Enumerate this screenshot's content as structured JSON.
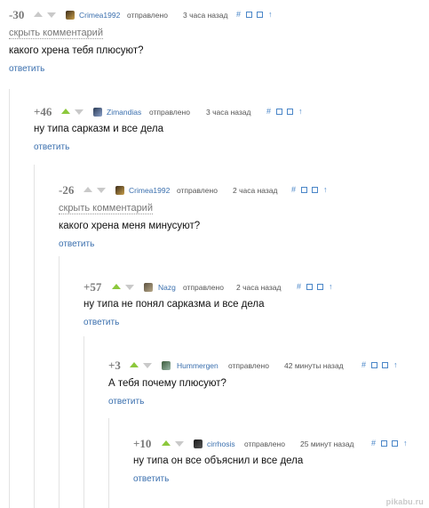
{
  "common": {
    "posted_label": "отправлено",
    "reply_label": "ответить",
    "hide_label": "скрыть комментарий",
    "tools": [
      "#",
      "⊟",
      "⊡",
      "↑"
    ],
    "colors": {
      "up_active": "#8cc83c",
      "arrow_inactive": "#c9c9c9",
      "username": "#3a6fae",
      "link": "#3a6fae"
    }
  },
  "comments": [
    {
      "score": "-30",
      "username": "Crimea1992",
      "time": "3 часа назад",
      "text": "какого хрена тебя плюсуют?",
      "up_active": false,
      "hidden_link": true
    },
    {
      "score": "+46",
      "username": "Zimandias",
      "time": "3 часа назад",
      "text": "ну типа сарказм и все дела",
      "up_active": true,
      "hidden_link": false
    },
    {
      "score": "-26",
      "username": "Crimea1992",
      "time": "2 часа назад",
      "text": "какого хрена меня минусуют?",
      "up_active": false,
      "hidden_link": true
    },
    {
      "score": "+57",
      "username": "Nazg",
      "time": "2 часа назад",
      "text": "ну типа не понял сарказма и все дела",
      "up_active": true,
      "hidden_link": false
    },
    {
      "score": "+3",
      "username": "Hummergen",
      "time": "42 минуты назад",
      "text": "А тебя почему плюсуют?",
      "up_active": true,
      "hidden_link": false
    },
    {
      "score": "+10",
      "username": "cirrhosis",
      "time": "25 минут назад",
      "text": "ну типа он все объяснил и все дела",
      "up_active": true,
      "hidden_link": false
    }
  ],
  "watermark": {
    "brand": "pikabu",
    "dot": ".",
    "tld": "ru"
  }
}
